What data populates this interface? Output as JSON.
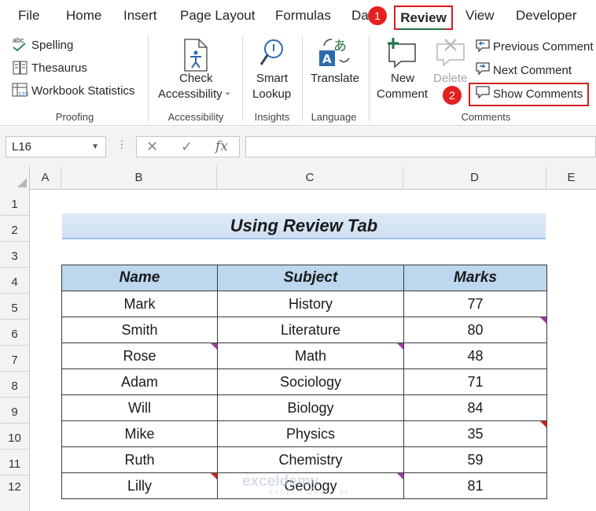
{
  "menu": {
    "tabs": [
      "File",
      "Home",
      "Insert",
      "Page Layout",
      "Formulas",
      "Data",
      "Review",
      "View",
      "Developer"
    ],
    "active_tab": "Review"
  },
  "badges": {
    "one": "1",
    "two": "2"
  },
  "ribbon": {
    "proofing": {
      "spelling": "Spelling",
      "thesaurus": "Thesaurus",
      "workbook_statistics": "Workbook Statistics",
      "group": "Proofing"
    },
    "accessibility": {
      "check_line1": "Check",
      "check_line2": "Accessibility",
      "group": "Accessibility"
    },
    "insights": {
      "smart_line1": "Smart",
      "smart_line2": "Lookup",
      "group": "Insights"
    },
    "language": {
      "translate": "Translate",
      "group": "Language"
    },
    "comments": {
      "new_line1": "New",
      "new_line2": "Comment",
      "delete": "Delete",
      "previous": "Previous Comment",
      "next": "Next Comment",
      "show": "Show Comments",
      "group": "Comments"
    },
    "spelling_abc": "abc"
  },
  "formula_bar": {
    "name_box": "L16",
    "fx": "fx",
    "value": ""
  },
  "grid": {
    "columns": [
      "A",
      "B",
      "C",
      "D",
      "E"
    ],
    "rows": [
      "1",
      "2",
      "3",
      "4",
      "5",
      "6",
      "7",
      "8",
      "9",
      "10",
      "11",
      "12"
    ]
  },
  "sheet": {
    "title": "Using Review Tab",
    "headers": [
      "Name",
      "Subject",
      "Marks"
    ],
    "rows": [
      {
        "name": "Mark",
        "subject": "History",
        "marks": "77"
      },
      {
        "name": "Smith",
        "subject": "Literature",
        "marks": "80"
      },
      {
        "name": "Rose",
        "subject": "Math",
        "marks": "48"
      },
      {
        "name": "Adam",
        "subject": "Sociology",
        "marks": "71"
      },
      {
        "name": "Will",
        "subject": "Biology",
        "marks": "84"
      },
      {
        "name": "Mike",
        "subject": "Physics",
        "marks": "35"
      },
      {
        "name": "Ruth",
        "subject": "Chemistry",
        "marks": "59"
      },
      {
        "name": "Lilly",
        "subject": "Geology",
        "marks": "81"
      }
    ]
  },
  "watermark": {
    "main": "exceldemy",
    "sub": "EXCEL · DATA · BI"
  },
  "colors": {
    "excel_green": "#217346",
    "highlight_red": "#d81e1e",
    "header_blue": "#bdd7ee",
    "note_indicator": "#a23ba4",
    "comment_indicator": "#d71f1f"
  }
}
